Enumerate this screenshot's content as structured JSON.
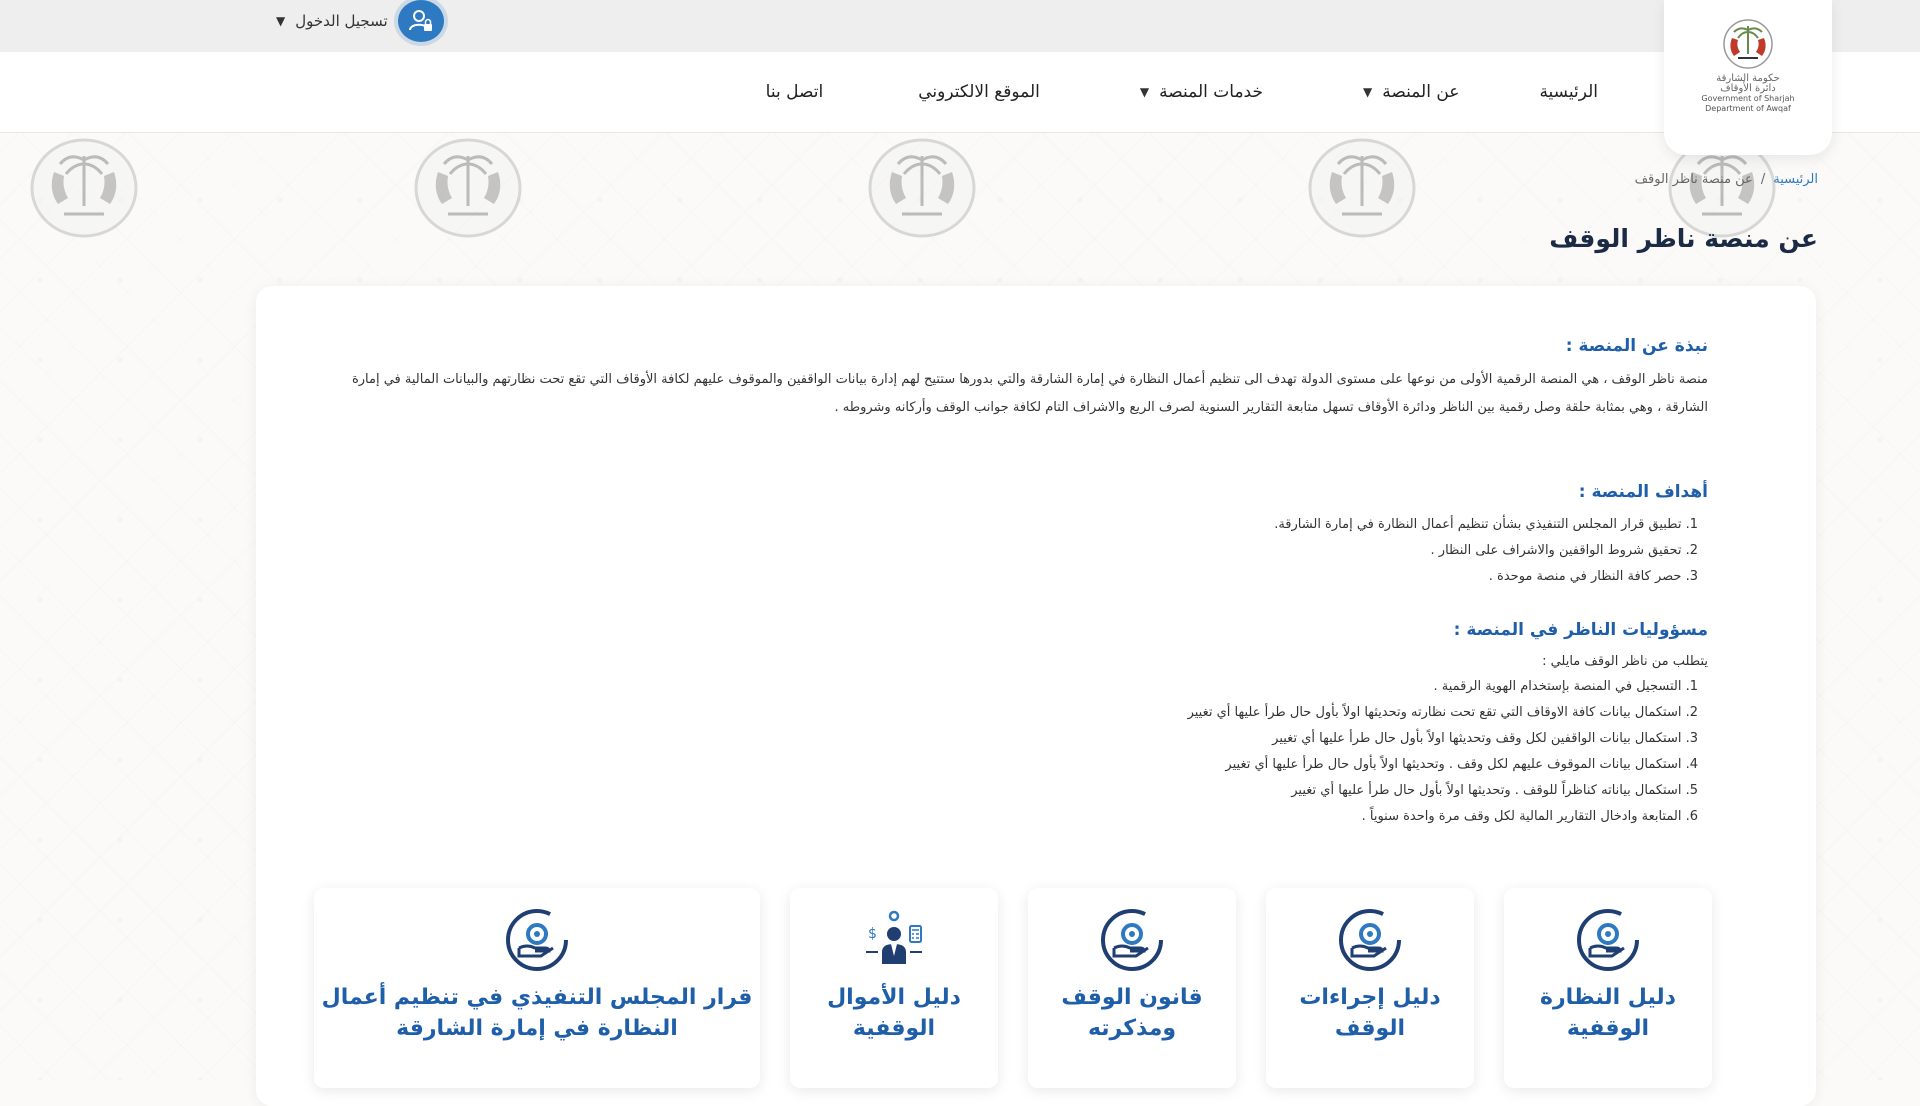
{
  "topbar": {
    "login_label": "تسجيل الدخول"
  },
  "nav": {
    "items": [
      {
        "label": "الرئيسية",
        "dropdown": false
      },
      {
        "label": "عن المنصة",
        "dropdown": true
      },
      {
        "label": "خدمات المنصة",
        "dropdown": true
      },
      {
        "label": "الموقع الالكتروني",
        "dropdown": false
      },
      {
        "label": "اتصل بنا",
        "dropdown": false
      }
    ]
  },
  "logo": {
    "arabic_line1": "حكومة الشارقة",
    "arabic_line2": "دائرة الأوقاف",
    "english_line1": "Government of Sharjah",
    "english_line2": "Department of Awqaf"
  },
  "breadcrumb": {
    "home": "الرئيسية",
    "current": "عن منصة ناظر الوقف"
  },
  "page_title": "عن منصة ناظر الوقف",
  "about": {
    "heading": "نبذة عن المنصة :",
    "paragraph": "منصة ناظر الوقف ، هي المنصة الرقمية الأولى من نوعها على مستوى الدولة تهدف الى تنظيم أعمال النظارة في إمارة الشارقة والتي بدورها ستتيح لهم إدارة بيانات الواقفين والموقوف عليهم لكافة الأوقاف التي تقع تحت نظارتهم والبيانات المالية في إمارة الشارقة ، وهي بمثابة حلقة وصل رقمية بين الناظر ودائرة الأوقاف تسهل متابعة التقارير السنوية لصرف الريع والاشراف التام لكافة جوانب الوقف وأركانه وشروطه ."
  },
  "goals": {
    "heading": "أهداف المنصة :",
    "items": [
      "1. تطبيق قرار المجلس التنفيذي بشأن تنظيم أعمال النظارة في إمارة الشارقة.",
      "2. تحقيق شروط الواقفين والاشراف على النظار .",
      "3. حصر كافة النظار في منصة موحدة ."
    ]
  },
  "responsibilities": {
    "heading": "مسؤوليات الناظر في المنصة :",
    "intro": "يتطلب من ناظر الوقف مايلي :",
    "items": [
      "1. التسجيل في المنصة بإستخدام الهوية الرقمية .",
      "2. استكمال بيانات كافة الاوقاف التي تقع تحت نظارته وتحديثها اولاً بأول حال طرأ عليها أي تغيير",
      "3. استكمال بيانات الواقفين لكل وقف وتحديثها اولاً بأول حال طرأ عليها أي تغيير",
      "4. استكمال بيانات الموقوف عليهم لكل وقف . وتحديثها اولاً بأول حال طرأ عليها أي تغيير",
      "5. استكمال بياناته كناظراً للوقف . وتحديثها اولاً بأول حال طرأ عليها أي تغيير",
      "6. المتابعة وادخال التقارير المالية لكل وقف مرة واحدة سنوياً ."
    ]
  },
  "services": [
    {
      "line1": "دليل النظارة",
      "line2": "الوقفية",
      "icon": "hand-gear-icon"
    },
    {
      "line1": "دليل إجراءات",
      "line2": "الوقف",
      "icon": "hand-gear-icon"
    },
    {
      "line1": "قانون الوقف",
      "line2": "ومذكرته",
      "icon": "hand-gear-icon"
    },
    {
      "line1": "دليل الأموال",
      "line2": "الوقفية",
      "icon": "finance-person-icon"
    },
    {
      "line1": "قرار المجلس التنفيذي في تنظيم أعمال",
      "line2": "النظارة في إمارة الشارقة",
      "icon": "hand-gear-icon"
    }
  ],
  "colors": {
    "primary_blue": "#1f5ea8",
    "accent_blue": "#2d79c2",
    "title_dark": "#1c2b45"
  }
}
